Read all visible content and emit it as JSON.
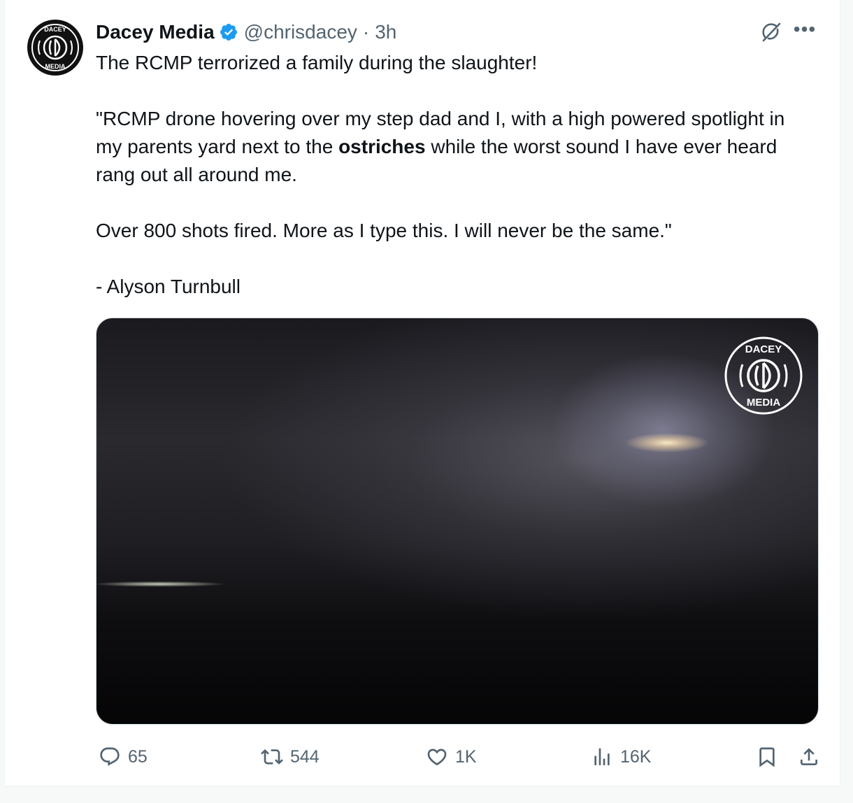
{
  "author": {
    "display_name": "Dacey Media",
    "handle": "@chrisdacey",
    "separator": "·",
    "time": "3h",
    "avatar_icon": "dacey-media-logo",
    "verified_icon": "verified-badge-icon"
  },
  "tweet": {
    "line1": "The RCMP terrorized a family during  the slaughter!",
    "para2_before": "\"RCMP drone hovering over my step dad and I, with a high powered spotlight in my parents yard next to the ",
    "para2_bold": "ostriches",
    "para2_after": " while the worst sound I have ever heard rang out all around me.",
    "para3": "Over 800 shots fired. More as I type this. I will never be the same.\"",
    "para4": "- Alyson Turnbull"
  },
  "media": {
    "watermark_icon": "dacey-media-watermark"
  },
  "actions": {
    "replies": "65",
    "reposts": "544",
    "likes": "1K",
    "views": "16K"
  },
  "colors": {
    "text": "#0f1419",
    "secondary": "#536471",
    "verified": "#1d9bf0",
    "border": "#cfd9de"
  }
}
